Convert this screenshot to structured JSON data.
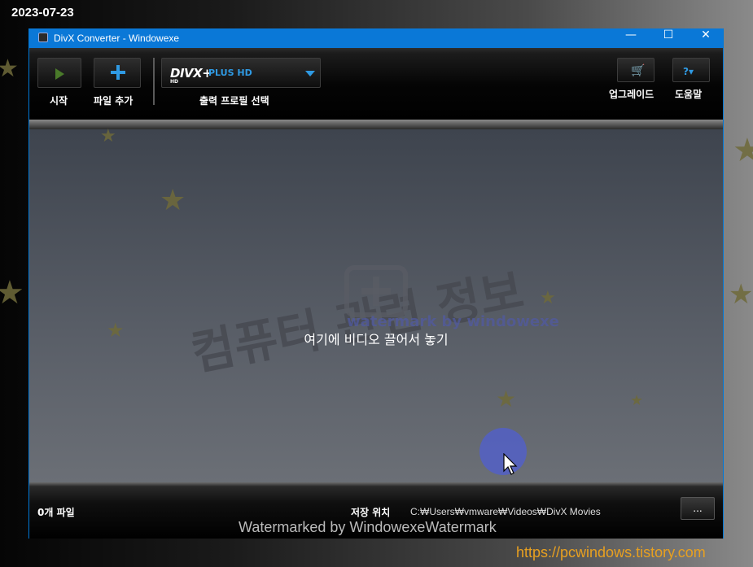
{
  "overlay": {
    "date": "2023-07-23",
    "watermark_top": "컴퓨터 관련 정보",
    "watermark_sub": "watermark by windowexe",
    "watermark_bottom": "Watermarked by WindowexeWatermark",
    "url": "https://pcwindows.tistory.com"
  },
  "window": {
    "title": "DivX Converter   - Windowexe",
    "controls": {
      "minimize": "—",
      "maximize": "☐",
      "close": "✕"
    }
  },
  "toolbar": {
    "start_label": "시작",
    "add_file_label": "파일 추가",
    "profile": {
      "logo": "DIVX+",
      "logo_sub": "HD",
      "name": "PLUS HD",
      "label": "출력 프로필 선택"
    },
    "upgrade_label": "업그레이드",
    "help_label": "도움말",
    "help_icon_text": "?▾"
  },
  "dropzone": {
    "hint": "여기에 비디오 끌어서 놓기"
  },
  "footer": {
    "file_count": "0개 파일",
    "save_location_label": "저장 위치",
    "save_path": "C:₩Users₩vmware₩Videos₩DivX Movies",
    "browse_label": "..."
  },
  "colors": {
    "titlebar": "#0a78d7",
    "accent": "#2f9ae3",
    "star": "#6f6a3a"
  }
}
